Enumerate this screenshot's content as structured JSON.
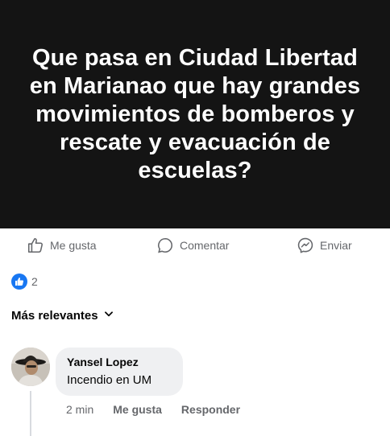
{
  "post": {
    "text": "Que pasa en Ciudad Libertad en Marianao que hay grandes movimientos de bomberos y rescate y evacuación de escuelas?",
    "background_color": "#141414"
  },
  "actions": {
    "like_label": "Me gusta",
    "comment_label": "Comentar",
    "share_label": "Enviar"
  },
  "reactions": {
    "count": "2",
    "icon": "like-badge-icon",
    "accent_color": "#1877f2"
  },
  "sort": {
    "label": "Más relevantes"
  },
  "comments": [
    {
      "author": "Yansel Lopez",
      "text": "Incendio en UM",
      "time": "2 min",
      "like_label": "Me gusta",
      "reply_label": "Responder"
    }
  ]
}
